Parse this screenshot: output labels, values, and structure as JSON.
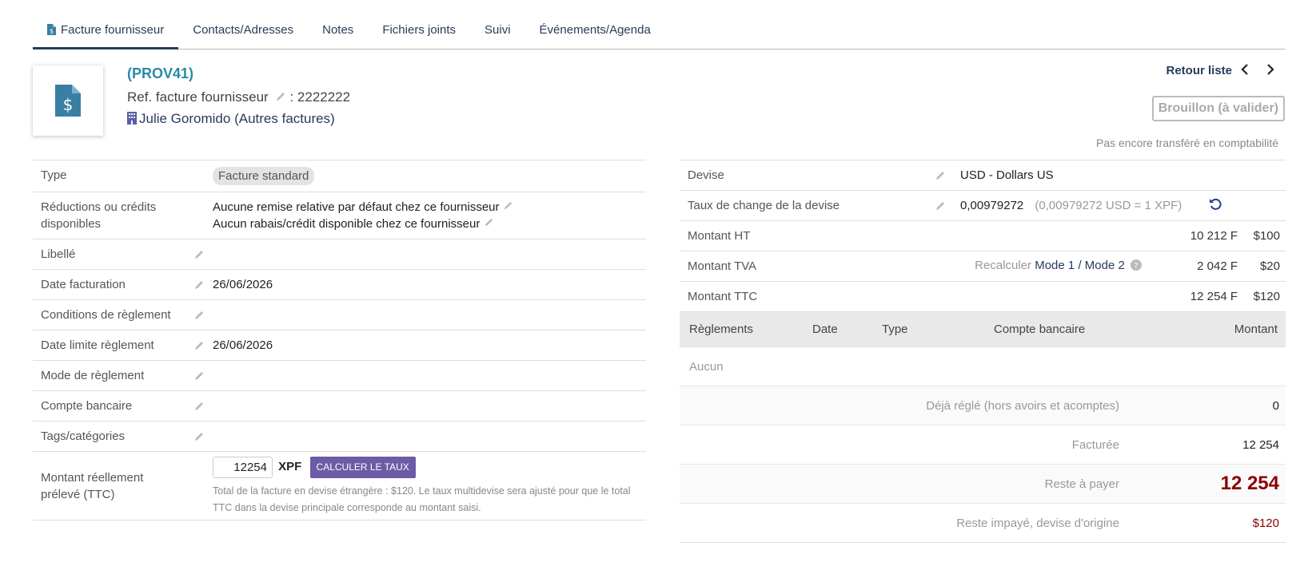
{
  "tabs": [
    {
      "label": "Facture fournisseur",
      "active": true
    },
    {
      "label": "Contacts/Adresses"
    },
    {
      "label": "Notes"
    },
    {
      "label": "Fichiers joints"
    },
    {
      "label": "Suivi"
    },
    {
      "label": "Événements/Agenda"
    }
  ],
  "header": {
    "ref": "(PROV41)",
    "ref_supplier_label": "Ref. facture fournisseur",
    "ref_supplier_sep": ":",
    "ref_supplier_value": "2222222",
    "supplier_name": "Julie Goromido",
    "other_invoices": "Autres factures",
    "back_to_list": "Retour liste",
    "status": "Brouillon (à valider)",
    "accounting_status": "Pas encore transféré en comptabilité"
  },
  "left": {
    "type_label": "Type",
    "type_value": "Facture standard",
    "discount_label": "Réductions ou crédits disponibles",
    "discount_line1": "Aucune remise relative par défaut chez ce fournisseur",
    "discount_line2": "Aucun rabais/crédit disponible chez ce fournisseur",
    "libelle_label": "Libellé",
    "date_label": "Date facturation",
    "date_value": "26/06/2026",
    "conditions_label": "Conditions de règlement",
    "due_label": "Date limite règlement",
    "due_value": "26/06/2026",
    "mode_label": "Mode de règlement",
    "bank_label": "Compte bancaire",
    "tags_label": "Tags/catégories",
    "real_amount_label": "Montant réellement prélevé (TTC)",
    "real_amount_value": "12254",
    "real_amount_currency": "XPF",
    "calc_button": "CALCULER LE TAUX",
    "help": "Total de la facture en devise étrangère : $120. Le taux multidevise sera ajusté pour que le total TTC dans la devise principale corresponde au montant saisi."
  },
  "right": {
    "currency_label": "Devise",
    "currency_value": "USD - Dollars US",
    "rate_label": "Taux de change de la devise",
    "rate_value": "0,00979272",
    "rate_detail": "(0,00979272 USD = 1 XPF)",
    "ht_label": "Montant HT",
    "ht_local": "10 212 F",
    "ht_foreign": "$100",
    "tva_label": "Montant TVA",
    "recalc_label": "Recalculer",
    "mode1": "Mode 1",
    "mode_sep": "/",
    "mode2": "Mode 2",
    "tva_local": "2 042 F",
    "tva_foreign": "$20",
    "ttc_label": "Montant TTC",
    "ttc_local": "12 254 F",
    "ttc_foreign": "$120"
  },
  "payments": {
    "columns": [
      "Règlements",
      "Date",
      "Type",
      "Compte bancaire",
      "Montant"
    ],
    "none": "Aucun",
    "already_paid_label": "Déjà réglé (hors avoirs et acomptes)",
    "already_paid_value": "0",
    "billed_label": "Facturée",
    "billed_value": "12 254",
    "remaining_label": "Reste à payer",
    "remaining_value": "12 254",
    "remaining_foreign_label": "Reste impayé, devise d'origine",
    "remaining_foreign_value": "$120"
  }
}
